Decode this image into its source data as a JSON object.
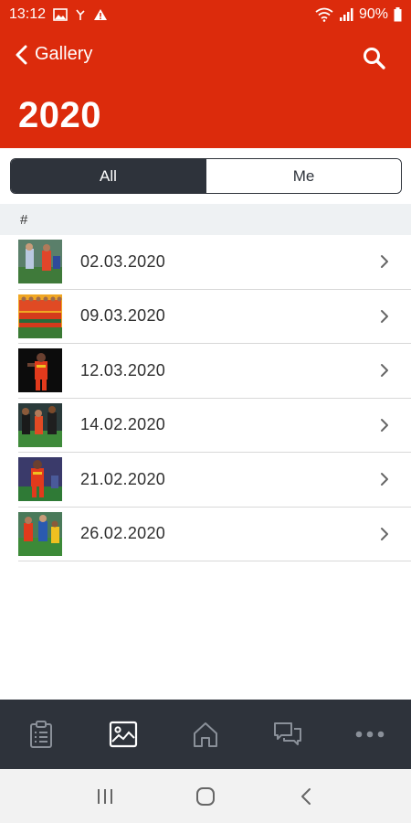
{
  "status_bar": {
    "time": "13:12",
    "battery": "90%",
    "icons_left": [
      "image-icon",
      "missed-call-icon",
      "warning-icon"
    ],
    "icons_right": [
      "wifi-icon",
      "signal-icon",
      "battery-icon"
    ]
  },
  "header": {
    "back_label": "Gallery",
    "title": "2020",
    "background_color": "#dc2b0c"
  },
  "filter_tabs": {
    "all_label": "All",
    "me_label": "Me",
    "selected": "All"
  },
  "list": {
    "section_header": "#",
    "items": [
      {
        "date": "02.03.2020"
      },
      {
        "date": "09.03.2020"
      },
      {
        "date": "12.03.2020"
      },
      {
        "date": "14.02.2020"
      },
      {
        "date": "21.02.2020"
      },
      {
        "date": "26.02.2020"
      }
    ]
  },
  "bottom_tabs": {
    "items": [
      "clipboard-icon",
      "gallery-icon",
      "home-icon",
      "chat-icon",
      "more-icon"
    ],
    "selected": "gallery-icon",
    "background_color": "#2e333b"
  },
  "system_nav": {
    "items": [
      "recents-icon",
      "home-button-icon",
      "back-nav-icon"
    ]
  }
}
